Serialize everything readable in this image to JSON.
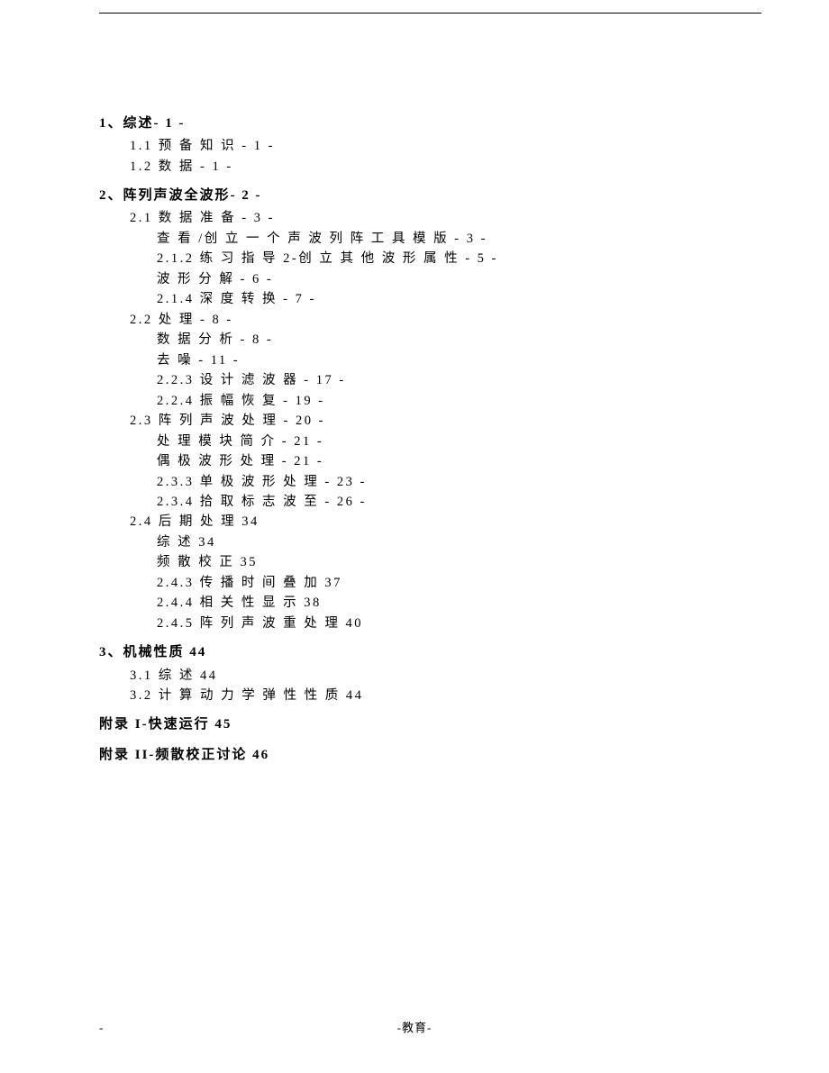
{
  "header_dashes": "--",
  "toc": {
    "s1": {
      "title": "1、综述- 1 -",
      "items": [
        "1.1 预 备 知 识 - 1 -",
        "1.2 数 据 - 1 -"
      ]
    },
    "s2": {
      "title": "2、阵列声波全波形- 2 -",
      "items": [
        {
          "l": 2,
          "t": "2.1 数 据 准 备 - 3 -"
        },
        {
          "l": 3,
          "t": "查 看 /创 立 一 个 声 波 列 阵 工 具 模 版 - 3 -"
        },
        {
          "l": 3,
          "t": "2.1.2  练 习 指 导 2-创 立 其 他 波 形 属 性 - 5 -"
        },
        {
          "l": 3,
          "t": "波 形 分 解 - 6 -"
        },
        {
          "l": 3,
          "t": "2.1.4 深 度 转 换 - 7 -"
        },
        {
          "l": 2,
          "t": "2.2  处 理 - 8 -"
        },
        {
          "l": 3,
          "t": "数 据 分 析 - 8 -"
        },
        {
          "l": 3,
          "t": "去 噪 - 11 -"
        },
        {
          "l": 3,
          "t": "2.2.3  设 计 滤 波 器 - 17 -"
        },
        {
          "l": 3,
          "t": "2.2.4  振 幅 恢 复 - 19 -"
        },
        {
          "l": 2,
          "t": "2.3 阵 列 声 波 处 理 - 20 -"
        },
        {
          "l": 3,
          "t": "处 理 模 块 简 介 - 21 -"
        },
        {
          "l": 3,
          "t": "偶 极 波 形 处 理 - 21 -"
        },
        {
          "l": 3,
          "t": "2.3.3  单 极 波 形 处 理 - 23 -"
        },
        {
          "l": 3,
          "t": "2.3.4  拾 取 标 志 波 至 - 26 -"
        },
        {
          "l": 2,
          "t": "2.4 后 期 处 理 34"
        },
        {
          "l": 3,
          "t": "综 述 34"
        },
        {
          "l": 3,
          "t": "频 散 校 正 35"
        },
        {
          "l": 3,
          "t": "2.4.3  传 播 时 间 叠 加 37"
        },
        {
          "l": 3,
          "t": "2.4.4  相 关 性 显 示 38"
        },
        {
          "l": 3,
          "t": "2.4.5  阵 列 声 波 重 处 理 40"
        }
      ]
    },
    "s3": {
      "title": "3、机械性质 44",
      "items": [
        "3.1 综 述 44",
        "3.2  计 算 动 力 学 弹 性 性 质 44"
      ]
    },
    "appendix1": "附录 I-快速运行 45",
    "appendix2": "附录 II-频散校正讨论 46"
  },
  "footer_center": "-教育-",
  "footer_left": "-"
}
